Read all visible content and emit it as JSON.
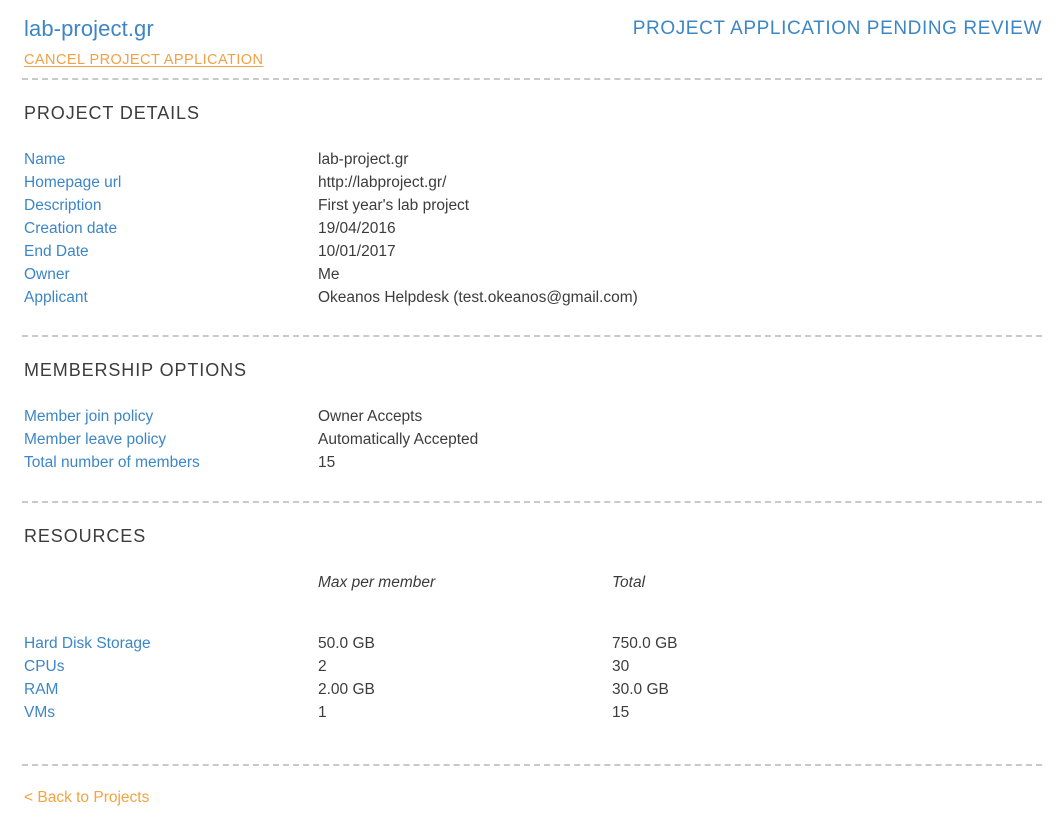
{
  "header": {
    "project_title": "lab-project.gr",
    "status": "PROJECT APPLICATION PENDING REVIEW",
    "cancel_label": "CANCEL PROJECT APPLICATION",
    "title_color": "#3d86c6",
    "link_color": "#f0a045"
  },
  "project_details": {
    "section_title": "PROJECT DETAILS",
    "rows": [
      {
        "label": "Name",
        "value": "lab-project.gr"
      },
      {
        "label": "Homepage url",
        "value": "http://labproject.gr/"
      },
      {
        "label": "Description",
        "value": "First year's lab project"
      },
      {
        "label": "Creation date",
        "value": "19/04/2016"
      },
      {
        "label": "End Date",
        "value": "10/01/2017"
      },
      {
        "label": "Owner",
        "value": "Me"
      },
      {
        "label": "Applicant",
        "value": "Okeanos Helpdesk (test.okeanos@gmail.com)"
      }
    ]
  },
  "membership_options": {
    "section_title": "MEMBERSHIP OPTIONS",
    "rows": [
      {
        "label": "Member join policy",
        "value": "Owner Accepts"
      },
      {
        "label": "Member leave policy",
        "value": "Automatically Accepted"
      },
      {
        "label": "Total number of members",
        "value": "15"
      }
    ]
  },
  "resources": {
    "section_title": "RESOURCES",
    "columns": {
      "name": "",
      "max_per_member": "Max per member",
      "total": "Total"
    },
    "rows": [
      {
        "name": "Hard Disk Storage",
        "max_per_member": "50.0 GB",
        "total": "750.0 GB"
      },
      {
        "name": "CPUs",
        "max_per_member": "2",
        "total": "30"
      },
      {
        "name": "RAM",
        "max_per_member": "2.00 GB",
        "total": "30.0 GB"
      },
      {
        "name": "VMs",
        "max_per_member": "1",
        "total": "15"
      }
    ]
  },
  "footer": {
    "back_label": "< Back to Projects"
  }
}
